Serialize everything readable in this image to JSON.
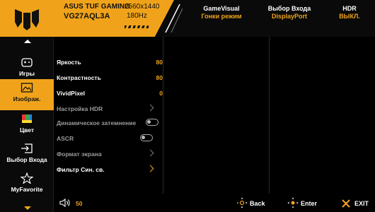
{
  "header": {
    "brand": "ASUS TUF GAMING",
    "model": "VG27AQL3A",
    "resolution": "2560x1440",
    "refresh": "180Hz",
    "status": [
      {
        "key": "GameVisual",
        "value": "Гонки режим"
      },
      {
        "key": "Выбор Входа",
        "value": "DisplayPort"
      },
      {
        "key": "HDR",
        "value": "ВЫКЛ."
      }
    ]
  },
  "sidebar": {
    "items": [
      {
        "label": "Игры",
        "icon": "gamepad-icon"
      },
      {
        "label": "Изображ.",
        "icon": "image-icon"
      },
      {
        "label": "Цвет",
        "icon": "color-icon"
      },
      {
        "label": "Выбор Входа",
        "icon": "input-icon"
      },
      {
        "label": "MyFavorite",
        "icon": "star-icon"
      }
    ],
    "active_index": 1
  },
  "settings": [
    {
      "label": "Яркость",
      "value": "80",
      "type": "value"
    },
    {
      "label": "Контрастность",
      "value": "80",
      "type": "value"
    },
    {
      "label": "VividPixel",
      "value": "0",
      "type": "value"
    },
    {
      "label": "Настройка HDR",
      "type": "submenu",
      "dim": true
    },
    {
      "label": "Динамическое затемнение",
      "type": "toggle",
      "dim": true
    },
    {
      "label": "ASCR",
      "type": "toggle",
      "dim": true
    },
    {
      "label": "Формат экрана",
      "type": "submenu",
      "dim": true
    },
    {
      "label": "Фильтр Син. св.",
      "type": "submenu"
    }
  ],
  "footer": {
    "volume": "50",
    "back": "Back",
    "enter": "Enter",
    "exit": "EXIT"
  },
  "colors": {
    "accent": "#f0a31a",
    "background": "#000000"
  }
}
